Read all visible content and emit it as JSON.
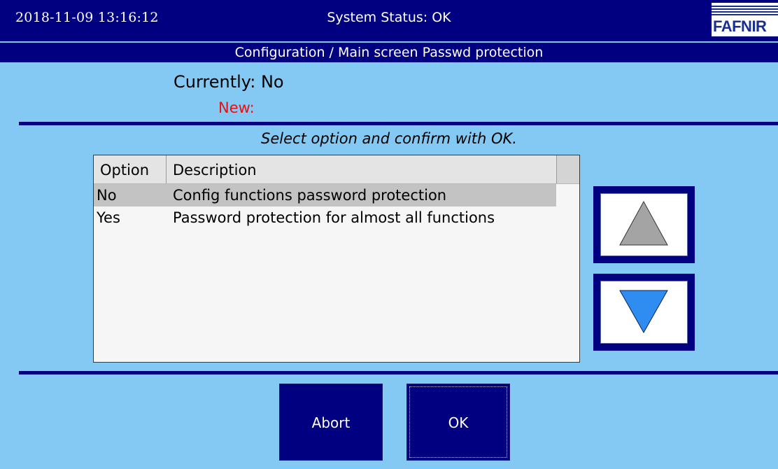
{
  "header": {
    "datetime": "2018-11-09  13:16:12",
    "status": "System Status: OK",
    "logo_text": "FAFNIR"
  },
  "title": "Configuration / Main screen Passwd protection",
  "current": {
    "currently_label": "Currently: No",
    "new_label": "New:"
  },
  "instruction": "Select option and confirm with OK.",
  "list": {
    "columns": [
      "Option",
      "Description"
    ],
    "rows": [
      {
        "option": "No",
        "description": "Config functions password protection",
        "selected": true
      },
      {
        "option": "Yes",
        "description": "Password protection for almost all functions",
        "selected": false
      }
    ]
  },
  "icons": {
    "scroll_up": "up-triangle-icon",
    "scroll_down": "down-triangle-icon"
  },
  "buttons": {
    "abort": "Abort",
    "ok": "OK"
  },
  "colors": {
    "background": "#84c8f4",
    "bar": "#000080",
    "new_label": "#e81010",
    "up_arrow": "#a4a4a4",
    "down_arrow": "#2f8cf0"
  }
}
